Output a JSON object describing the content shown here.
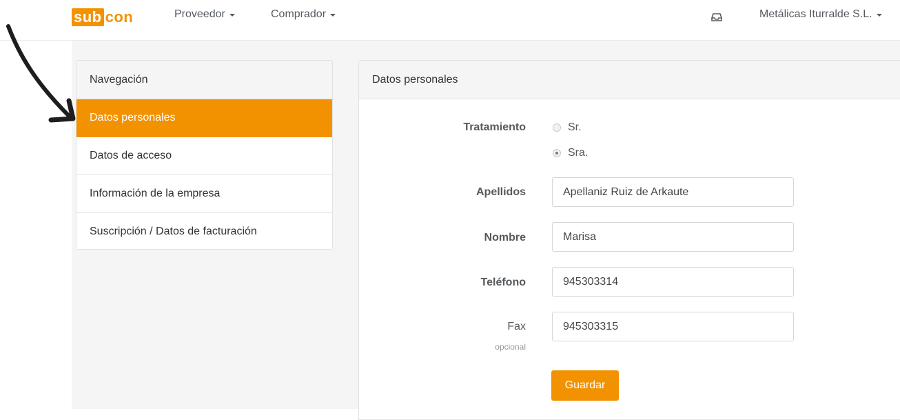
{
  "brand": {
    "logo_part1": "sub",
    "logo_part2": "con",
    "accent_color": "#f39200"
  },
  "navbar": {
    "menu_proveedor": "Proveedor",
    "menu_comprador": "Comprador",
    "inbox_icon": "inbox-icon",
    "user_name": "Metálicas Iturralde S.L."
  },
  "sidebar": {
    "title": "Navegación",
    "items": [
      {
        "label": "Datos personales",
        "active": true
      },
      {
        "label": "Datos de acceso",
        "active": false
      },
      {
        "label": "Información de la empresa",
        "active": false
      },
      {
        "label": "Suscripción / Datos de facturación",
        "active": false
      }
    ]
  },
  "form": {
    "title": "Datos personales",
    "tratamiento": {
      "label": "Tratamiento",
      "options": [
        {
          "label": "Sr.",
          "checked": false
        },
        {
          "label": "Sra.",
          "checked": true
        }
      ]
    },
    "apellidos": {
      "label": "Apellidos",
      "value": "Apellaniz Ruiz de Arkaute"
    },
    "nombre": {
      "label": "Nombre",
      "value": "Marisa"
    },
    "telefono": {
      "label": "Teléfono",
      "value": "945303314"
    },
    "fax": {
      "label": "Fax",
      "hint": "opcional",
      "value": "945303315"
    },
    "save_label": "Guardar"
  }
}
